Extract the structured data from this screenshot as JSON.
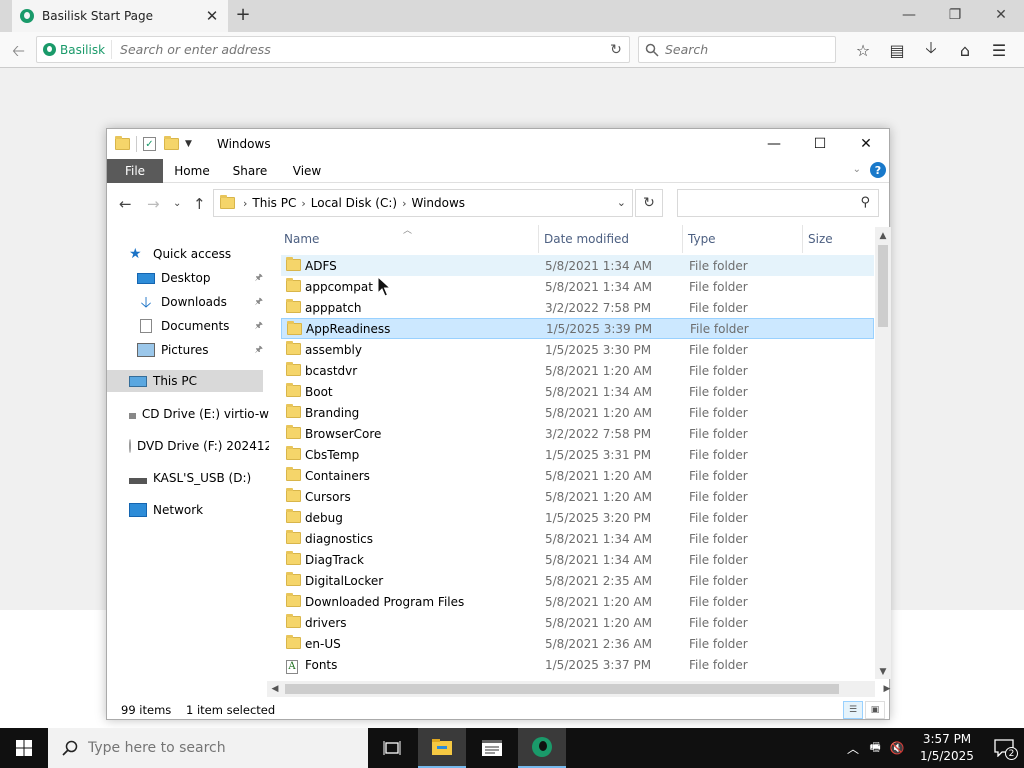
{
  "browser": {
    "tab_title": "Basilisk Start Page",
    "identity_label": "Basilisk",
    "url_placeholder": "Search or enter address",
    "search_placeholder": "Search"
  },
  "explorer": {
    "window_title": "Windows",
    "ribbon_tabs": [
      "File",
      "Home",
      "Share",
      "View"
    ],
    "breadcrumb": [
      "This PC",
      "Local Disk (C:)",
      "Windows"
    ],
    "search_value": "",
    "nav": {
      "quick_access": "Quick access",
      "desktop": "Desktop",
      "downloads": "Downloads",
      "documents": "Documents",
      "pictures": "Pictures",
      "this_pc": "This PC",
      "cd_drive": "CD Drive (E:) virtio-w",
      "dvd_drive": "DVD Drive (F:) 202412",
      "usb_drive": "KASL'S_USB (D:)",
      "network": "Network"
    },
    "columns": [
      "Name",
      "Date modified",
      "Type",
      "Size"
    ],
    "rows": [
      {
        "name": "ADFS",
        "date": "5/8/2021 1:34 AM",
        "type": "File folder"
      },
      {
        "name": "appcompat",
        "date": "5/8/2021 1:34 AM",
        "type": "File folder"
      },
      {
        "name": "apppatch",
        "date": "3/2/2022 7:58 PM",
        "type": "File folder"
      },
      {
        "name": "AppReadiness",
        "date": "1/5/2025 3:39 PM",
        "type": "File folder"
      },
      {
        "name": "assembly",
        "date": "1/5/2025 3:30 PM",
        "type": "File folder"
      },
      {
        "name": "bcastdvr",
        "date": "5/8/2021 1:20 AM",
        "type": "File folder"
      },
      {
        "name": "Boot",
        "date": "5/8/2021 1:34 AM",
        "type": "File folder"
      },
      {
        "name": "Branding",
        "date": "5/8/2021 1:20 AM",
        "type": "File folder"
      },
      {
        "name": "BrowserCore",
        "date": "3/2/2022 7:58 PM",
        "type": "File folder"
      },
      {
        "name": "CbsTemp",
        "date": "1/5/2025 3:31 PM",
        "type": "File folder"
      },
      {
        "name": "Containers",
        "date": "5/8/2021 1:20 AM",
        "type": "File folder"
      },
      {
        "name": "Cursors",
        "date": "5/8/2021 1:20 AM",
        "type": "File folder"
      },
      {
        "name": "debug",
        "date": "1/5/2025 3:20 PM",
        "type": "File folder"
      },
      {
        "name": "diagnostics",
        "date": "5/8/2021 1:34 AM",
        "type": "File folder"
      },
      {
        "name": "DiagTrack",
        "date": "5/8/2021 1:34 AM",
        "type": "File folder"
      },
      {
        "name": "DigitalLocker",
        "date": "5/8/2021 2:35 AM",
        "type": "File folder"
      },
      {
        "name": "Downloaded Program Files",
        "date": "5/8/2021 1:20 AM",
        "type": "File folder"
      },
      {
        "name": "drivers",
        "date": "5/8/2021 1:20 AM",
        "type": "File folder"
      },
      {
        "name": "en-US",
        "date": "5/8/2021 2:36 AM",
        "type": "File folder"
      },
      {
        "name": "Fonts",
        "date": "1/5/2025 3:37 PM",
        "type": "File folder"
      }
    ],
    "status_count": "99 items",
    "status_selected": "1 item selected"
  },
  "taskbar": {
    "search_placeholder": "Type here to search",
    "time": "3:57 PM",
    "date": "1/5/2025",
    "notification_count": "2"
  },
  "colors": {
    "accent": "#1a9a6a",
    "selection": "#cce8ff",
    "hover": "#e5f3fb",
    "taskbar": "#101010"
  }
}
